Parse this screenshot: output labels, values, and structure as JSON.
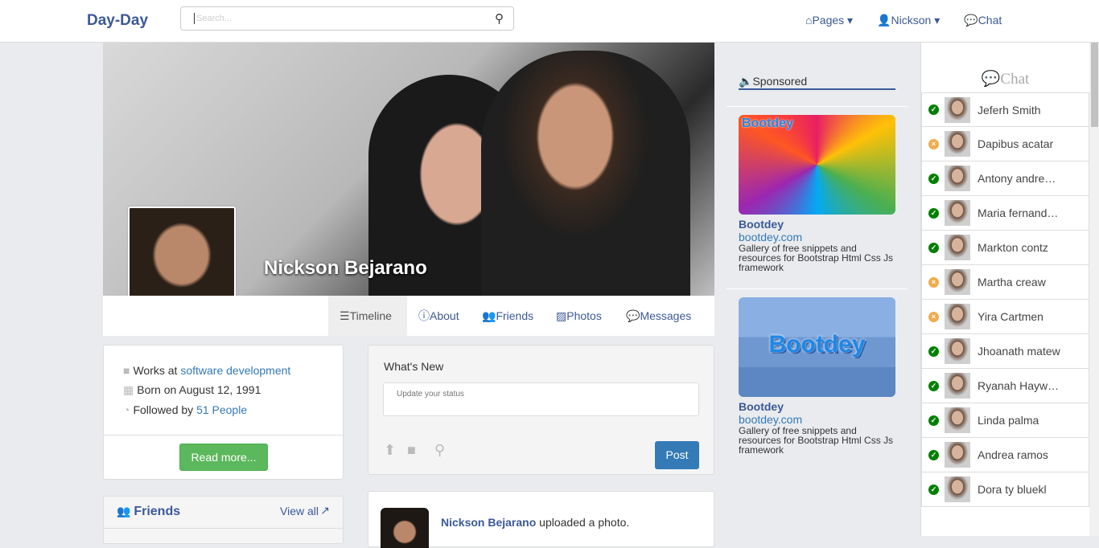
{
  "nav": {
    "brand": "Day-Day",
    "search_placeholder": "Search...",
    "links": [
      {
        "label": "Pages",
        "icon": "home-icon"
      },
      {
        "label": "Nickson",
        "icon": "user-icon"
      },
      {
        "label": "Chat",
        "icon": "comment-icon"
      }
    ]
  },
  "profile": {
    "name": "Nickson Bejarano",
    "tabs": [
      "Timeline",
      "About",
      "Friends",
      "Photos",
      "Messages"
    ],
    "active_tab": "Timeline"
  },
  "info": {
    "works_prefix": "Works at",
    "works_link": "software development",
    "born": "Born on August 12, 1991",
    "followed_prefix": "Followed by",
    "followed_link": "51 People",
    "read_more": "Read more..."
  },
  "friends": {
    "title": "Friends",
    "view_all": "View all"
  },
  "status": {
    "title": "What's New",
    "placeholder": "Update your status",
    "post": "Post"
  },
  "feed": {
    "author": "Nickson Bejarano",
    "action": "uploaded a photo."
  },
  "sponsored": {
    "title": "Sponsored",
    "ads": [
      {
        "image_text": "Bootdey",
        "title": "Bootdey",
        "link": "bootdey.com",
        "desc": "Gallery of free snippets and resources for Bootstrap Html Css Js framework"
      },
      {
        "image_text": "Bootdey",
        "title": "Bootdey",
        "link": "bootdey.com",
        "desc": "Gallery of free snippets and resources for Bootstrap Html Css Js framework"
      }
    ]
  },
  "chat": {
    "title": "Chat",
    "online_color": "#008000",
    "away_color": "#f0ad4e",
    "users": [
      {
        "name": "Jeferh Smith",
        "status": "online"
      },
      {
        "name": "Dapibus acatar",
        "status": "away"
      },
      {
        "name": "Antony andrew lobghi",
        "status": "online"
      },
      {
        "name": "Maria fernanda coronel",
        "status": "online"
      },
      {
        "name": "Markton contz",
        "status": "online"
      },
      {
        "name": "Martha creaw",
        "status": "away"
      },
      {
        "name": "Yira Cartmen",
        "status": "away"
      },
      {
        "name": "Jhoanath matew",
        "status": "online"
      },
      {
        "name": "Ryanah Haywofd",
        "status": "online"
      },
      {
        "name": "Linda palma",
        "status": "online"
      },
      {
        "name": "Andrea ramos",
        "status": "online"
      },
      {
        "name": "Dora ty bluekl",
        "status": "online"
      }
    ]
  }
}
